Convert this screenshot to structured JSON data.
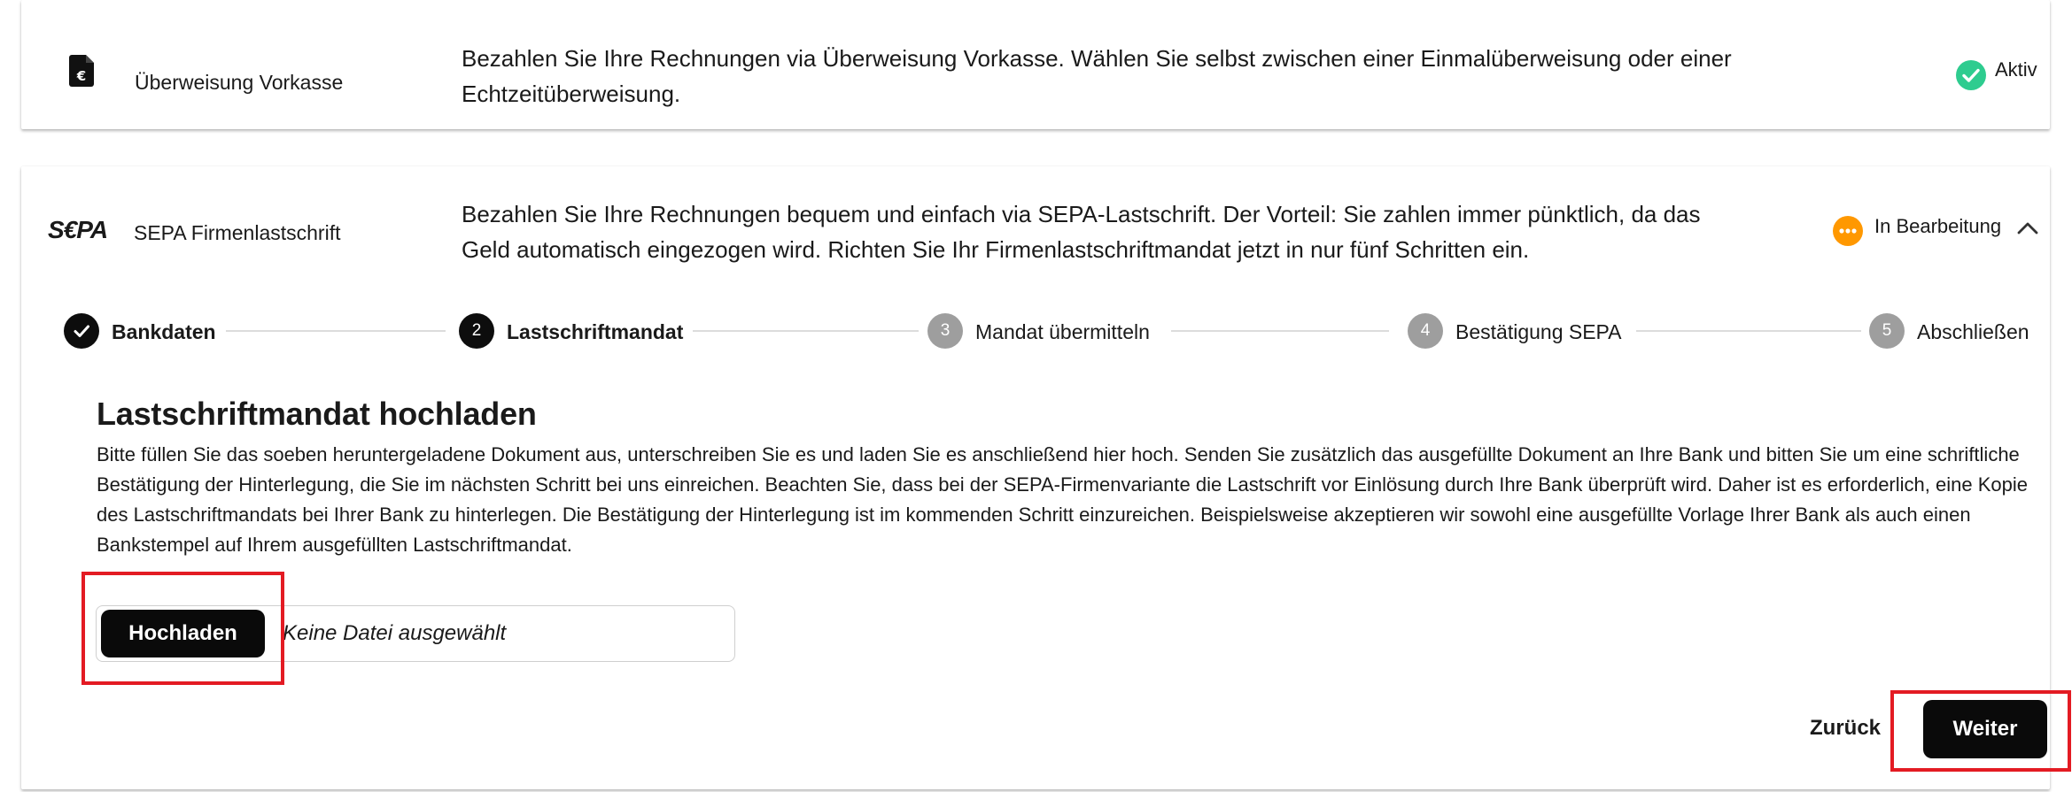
{
  "method1": {
    "name": "Überweisung Vorkasse",
    "description": "Bezahlen Sie Ihre Rechnungen via Überweisung Vorkasse. Wählen Sie selbst zwischen einer Einmalüberweisung oder einer Echtzeitüberweisung.",
    "status": "Aktiv",
    "status_color": "#2ecc8f",
    "icon": "euro-document-icon"
  },
  "method2": {
    "logo": "S€PA",
    "name": "SEPA Firmenlastschrift",
    "description": "Bezahlen Sie Ihre Rechnungen bequem und einfach via SEPA-Lastschrift. Der Vorteil: Sie zahlen immer pünktlich, da das Geld automatisch eingezogen wird. Richten Sie Ihr Firmenlastschriftmandat jetzt in nur fünf Schritten ein.",
    "status": "In Bearbeitung",
    "status_color": "#ff9800",
    "icon": "chevron-up-icon"
  },
  "stepper": {
    "steps": [
      {
        "number": "",
        "label": "Bankdaten",
        "state": "done"
      },
      {
        "number": "2",
        "label": "Lastschriftmandat",
        "state": "active"
      },
      {
        "number": "3",
        "label": "Mandat übermitteln",
        "state": "pending"
      },
      {
        "number": "4",
        "label": "Bestätigung SEPA",
        "state": "pending"
      },
      {
        "number": "5",
        "label": "Abschließen",
        "state": "pending"
      }
    ]
  },
  "upload": {
    "title": "Lastschriftmandat hochladen",
    "text": "Bitte füllen Sie das soeben heruntergeladene Dokument aus, unterschreiben Sie es und laden Sie es anschließend hier hoch. Senden Sie zusätzlich das ausgefüllte Dokument an Ihre Bank und bitten Sie um eine schriftliche Bestätigung der Hinterlegung, die Sie im nächsten Schritt bei uns einreichen. Beachten Sie, dass bei der SEPA-Firmenvariante die Lastschrift vor Einlösung durch Ihre Bank überprüft wird. Daher ist es erforderlich, eine Kopie des Lastschriftmandats bei Ihrer Bank zu hinterlegen. Die Bestätigung der Hinterlegung ist im kommenden Schritt einzureichen. Beispielsweise akzeptieren wir sowohl eine ausgefüllte Vorlage Ihrer Bank als auch einen Bankstempel auf Ihrem ausgefüllten Lastschriftmandat.",
    "button_label": "Hochladen",
    "file_status": "Keine Datei ausgewählt"
  },
  "footer": {
    "back_label": "Zurück",
    "next_label": "Weiter"
  },
  "colors": {
    "highlight": "#e31b23",
    "primary": "#0a0a0a"
  }
}
